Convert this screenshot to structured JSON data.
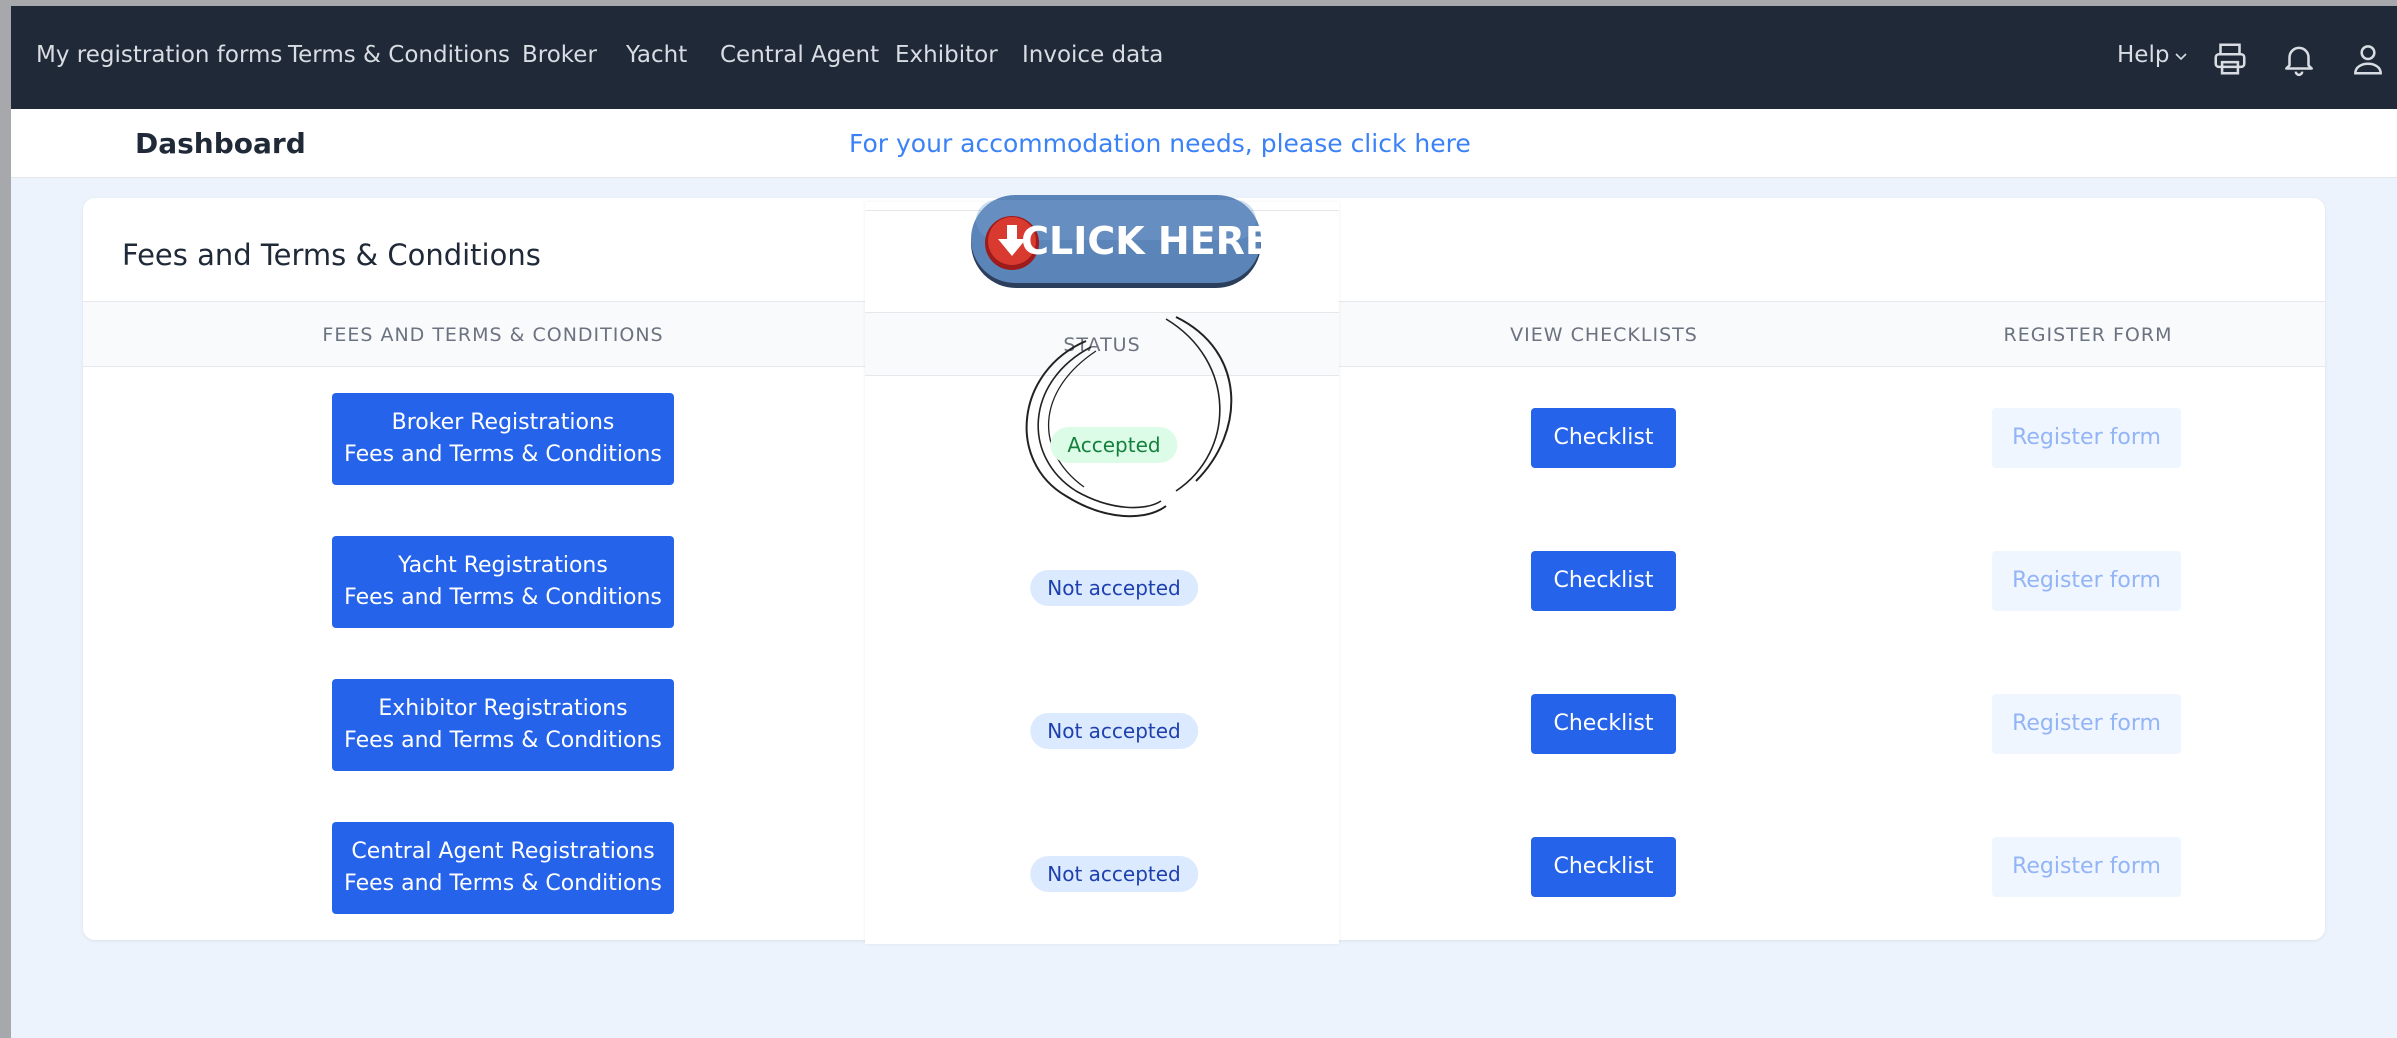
{
  "navbar": {
    "links": [
      "My registration forms",
      "Terms & Conditions",
      "Broker",
      "Yacht",
      "Central Agent",
      "Exhibitor",
      "Invoice data"
    ],
    "help_label": "Help",
    "icons": [
      "printer-icon",
      "bell-icon",
      "user-icon"
    ]
  },
  "subheader": {
    "title": "Dashboard",
    "accommodation_link": "For your accommodation needs, please click here"
  },
  "card": {
    "title": "Fees and Terms & Conditions",
    "columns": [
      "FEES AND TERMS & CONDITIONS",
      "STATUS",
      "VIEW CHECKLISTS",
      "REGISTER FORM"
    ],
    "rows": [
      {
        "fees_line1": "Broker Registrations",
        "fees_line2": "Fees and Terms & Conditions",
        "status": "Accepted",
        "checklist": "Checklist",
        "register": "Register form"
      },
      {
        "fees_line1": "Yacht Registrations",
        "fees_line2": "Fees and Terms & Conditions",
        "status": "Not accepted",
        "checklist": "Checklist",
        "register": "Register form"
      },
      {
        "fees_line1": "Exhibitor Registrations",
        "fees_line2": "Fees and Terms & Conditions",
        "status": "Not accepted",
        "checklist": "Checklist",
        "register": "Register form"
      },
      {
        "fees_line1": "Central Agent Registrations",
        "fees_line2": "Fees and Terms & Conditions",
        "status": "Not accepted",
        "checklist": "Checklist",
        "register": "Register form"
      }
    ]
  },
  "overlay": {
    "click_here_label": "CLICK HERE"
  },
  "colors": {
    "navbar_bg": "#1f2937",
    "primary": "#2563eb",
    "link": "#3b82f6",
    "accepted_bg": "#dcfce7",
    "not_accepted_bg": "#dbeafe"
  }
}
